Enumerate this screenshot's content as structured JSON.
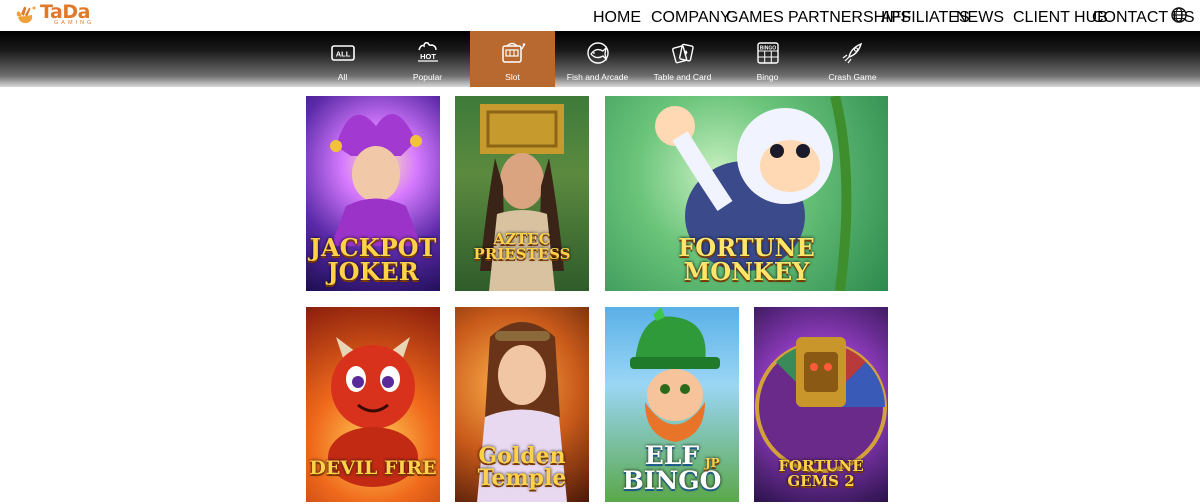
{
  "brand": {
    "name": "TaDa",
    "sub": "GAMING"
  },
  "nav": [
    "HOME",
    "COMPANY",
    "GAMES",
    "PARTNERSHIPS",
    "AFFILIATES",
    "NEWS",
    "CLIENT HUB",
    "CONTACT US"
  ],
  "categories": [
    {
      "label": "All",
      "icon": "all-icon"
    },
    {
      "label": "Popular",
      "icon": "hot-icon"
    },
    {
      "label": "Slot",
      "icon": "slot-machine-icon",
      "active": true
    },
    {
      "label": "Fish and Arcade",
      "icon": "fish-icon"
    },
    {
      "label": "Table and Card",
      "icon": "cards-icon"
    },
    {
      "label": "Bingo",
      "icon": "bingo-icon"
    },
    {
      "label": "Crash Game",
      "icon": "rocket-icon"
    }
  ],
  "games": [
    {
      "title": "JACKPOT\nJOKER"
    },
    {
      "title": "AZTEC PRIESTESS"
    },
    {
      "title": "FORTUNE\nMONKEY"
    },
    {
      "title": "DEVIL FIRE"
    },
    {
      "title": "Golden\nTemple"
    },
    {
      "title": "ELF\nBINGO",
      "badge": "JP"
    },
    {
      "title": "FORTUNE GEMS 2"
    }
  ],
  "colors": {
    "accent": "#b8692f",
    "brand": "#e07a2a"
  }
}
